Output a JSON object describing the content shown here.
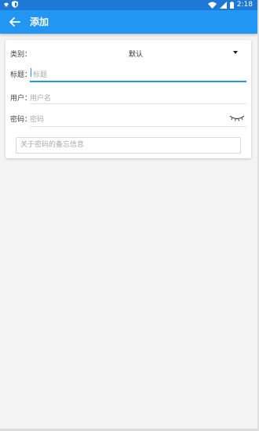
{
  "status_bar": {
    "time": "2:18",
    "icons": [
      "notification-icon",
      "shield-icon",
      "wifi-icon",
      "signal-icon",
      "battery-icon"
    ]
  },
  "app_bar": {
    "title": "添加",
    "back_icon": "arrow-left-icon",
    "background": "#2196f3"
  },
  "form": {
    "type_label": "类别：",
    "type_value": "默认",
    "title_label": "标题：",
    "title_placeholder": "标题",
    "user_label": "用户：",
    "user_placeholder": "用户名",
    "password_label": "密码：",
    "password_placeholder": "密码",
    "note_placeholder": "关于密码的备忘信息",
    "accent": "#2196f3"
  }
}
